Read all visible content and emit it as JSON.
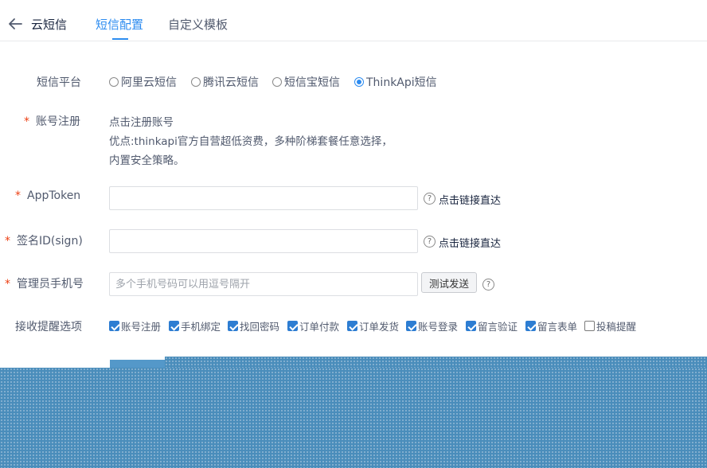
{
  "header": {
    "app_title": "云短信",
    "tabs": [
      {
        "label": "短信配置",
        "active": true
      },
      {
        "label": "自定义模板",
        "active": false
      }
    ]
  },
  "form": {
    "platform": {
      "label": "短信平台",
      "options": [
        {
          "label": "阿里云短信",
          "selected": false
        },
        {
          "label": "腾讯云短信",
          "selected": false
        },
        {
          "label": "短信宝短信",
          "selected": false
        },
        {
          "label": "ThinkApi短信",
          "selected": true
        }
      ]
    },
    "account": {
      "required_mark": "*",
      "label": "账号注册",
      "link": "点击注册账号",
      "desc_line1": "优点:thinkapi官方自营超低资费，多种阶梯套餐任意选择，",
      "desc_line2": "内置安全策略。"
    },
    "apptoken": {
      "required_mark": "*",
      "label": "AppToken",
      "value": "",
      "help_link": "点击链接直达"
    },
    "sign": {
      "required_mark": "*",
      "label": "签名ID(sign)",
      "value": "",
      "help_link": "点击链接直达"
    },
    "admin_phone": {
      "required_mark": "*",
      "label": "管理员手机号",
      "placeholder": "多个手机号码可以用逗号隔开",
      "test_button": "测试发送"
    },
    "notify": {
      "label": "接收提醒选项",
      "options": [
        {
          "label": "账号注册",
          "checked": true
        },
        {
          "label": "手机绑定",
          "checked": true
        },
        {
          "label": "找回密码",
          "checked": true
        },
        {
          "label": "订单付款",
          "checked": true
        },
        {
          "label": "订单发货",
          "checked": true
        },
        {
          "label": "账号登录",
          "checked": true
        },
        {
          "label": "留言验证",
          "checked": true
        },
        {
          "label": "留言表单",
          "checked": true
        },
        {
          "label": "投稿提醒",
          "checked": false
        }
      ]
    }
  },
  "colors": {
    "accent": "#2d8cf0",
    "required": "#ed4014",
    "checkbox": "#2d7dd2",
    "overlay": "#4a8dbb"
  }
}
